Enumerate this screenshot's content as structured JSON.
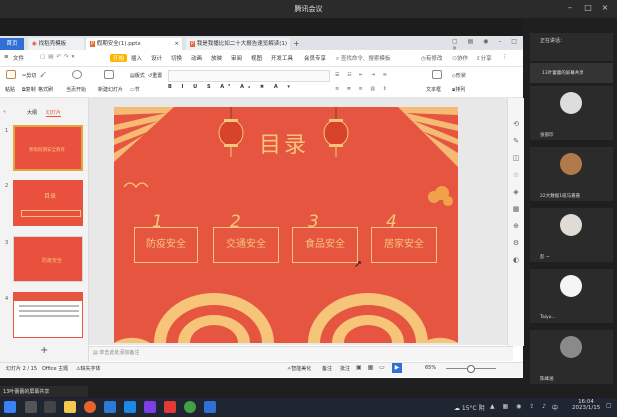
{
  "meeting": {
    "title": "腾讯会议",
    "speaking": "正在讲话："
  },
  "tabs": {
    "home": "首页",
    "t1": "找稻壳模板",
    "t2": "假期安全(1).pptx",
    "t3": "我是我播比如二十大报告速览解读(1)"
  },
  "menu": {
    "file": "文件",
    "start": "开始",
    "insert": "插入",
    "design": "设计",
    "switch": "切换",
    "anim": "动画",
    "show": "放映",
    "review": "审阅",
    "view": "视图",
    "dev": "开发工具",
    "vip": "会员专享",
    "search": "查找命令、搜索模板",
    "collab": "协作",
    "share": "分享",
    "history": "有修改"
  },
  "toolbar": {
    "paste": "粘贴",
    "cut": "剪切",
    "copy": "复制",
    "format": "格式刷",
    "play": "当页开始",
    "newslide": "新建幻灯片",
    "layout": "版式",
    "section": "节",
    "reset": "重置",
    "textbox": "文本框",
    "shape": "形状",
    "arrange": "排列"
  },
  "leftpanel": {
    "outline": "大纲",
    "slides": "幻灯片",
    "add": "+",
    "thumbs": [
      {
        "num": "1",
        "text": "寒假假期安全教育"
      },
      {
        "num": "2",
        "text": "目录"
      },
      {
        "num": "3",
        "text": "防疫安全"
      },
      {
        "num": "4",
        "text": ""
      }
    ]
  },
  "slide": {
    "title": "目录",
    "items": [
      {
        "n": "1",
        "label": "防疫安全"
      },
      {
        "n": "2",
        "label": "交通安全"
      },
      {
        "n": "3",
        "label": "食品安全"
      },
      {
        "n": "4",
        "label": "居家安全"
      }
    ]
  },
  "notes": {
    "placeholder": "单击此处添加备注"
  },
  "status": {
    "page": "幻灯片 2 / 15",
    "theme": "Office 主题",
    "font": "缺失字体",
    "beautify": "智能美化",
    "notes_btn": "备注",
    "comments": "批注",
    "zoom": "65%"
  },
  "participants": [
    {
      "name": "13叶蕾蕾的屏幕共享"
    },
    {
      "name": "张丽珍"
    },
    {
      "name": "22大数据1班马嘉嘉"
    },
    {
      "name": "彭 ~"
    },
    {
      "name": "Taiyu..."
    },
    {
      "name": "陈峰涵"
    }
  ],
  "share_status": "13叶蕾蕾的屏幕共享",
  "taskbar": {
    "weather": "15°C 阴",
    "time": "16:04",
    "date": "2023/1/15",
    "lang": "中"
  },
  "colors": {
    "slide_red": "#e55540",
    "gold": "#f6c57a",
    "wps_blue": "#2f6fd6"
  }
}
